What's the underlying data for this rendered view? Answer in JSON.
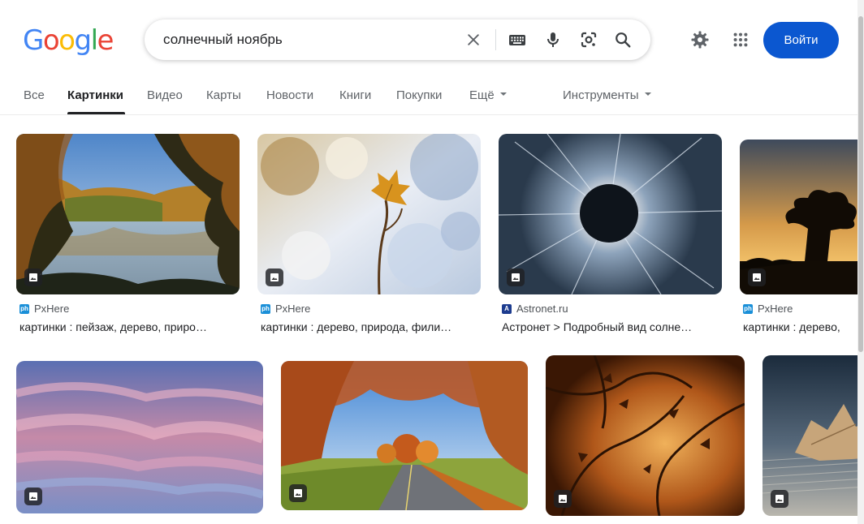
{
  "logo": [
    "G",
    "o",
    "o",
    "g",
    "l",
    "e"
  ],
  "logo_colors": [
    "#4285F4",
    "#EA4335",
    "#FBBC05",
    "#4285F4",
    "#34A853",
    "#EA4335"
  ],
  "search": {
    "value": "солнечный ноябрь"
  },
  "icons": {
    "clear": "close-icon",
    "keyboard": "keyboard-icon",
    "voice": "microphone-icon",
    "lens": "camera-lens-icon",
    "search": "search-icon",
    "settings": "gear-icon",
    "apps": "apps-grid-icon"
  },
  "header": {
    "login_label": "Войти",
    "accent": "#0b57d0"
  },
  "tabs": [
    {
      "label": "Все"
    },
    {
      "label": "Картинки",
      "active": true
    },
    {
      "label": "Видео"
    },
    {
      "label": "Карты"
    },
    {
      "label": "Новости"
    },
    {
      "label": "Книги"
    },
    {
      "label": "Покупки"
    },
    {
      "label": "Ещё"
    }
  ],
  "tools_label": "Инструменты",
  "results": [
    {
      "source": "PxHere",
      "title": "картинки : пейзаж, дерево, приро…"
    },
    {
      "source": "PxHere",
      "title": "картинки : дерево, природа, фили…"
    },
    {
      "source": "Astronet.ru",
      "title": "Астронет > Подробный вид солне…"
    },
    {
      "source": "PxHere",
      "title": "картинки : дерево,"
    },
    {
      "source": "",
      "title": ""
    },
    {
      "source": "",
      "title": ""
    },
    {
      "source": "",
      "title": ""
    },
    {
      "source": "",
      "title": ""
    }
  ]
}
